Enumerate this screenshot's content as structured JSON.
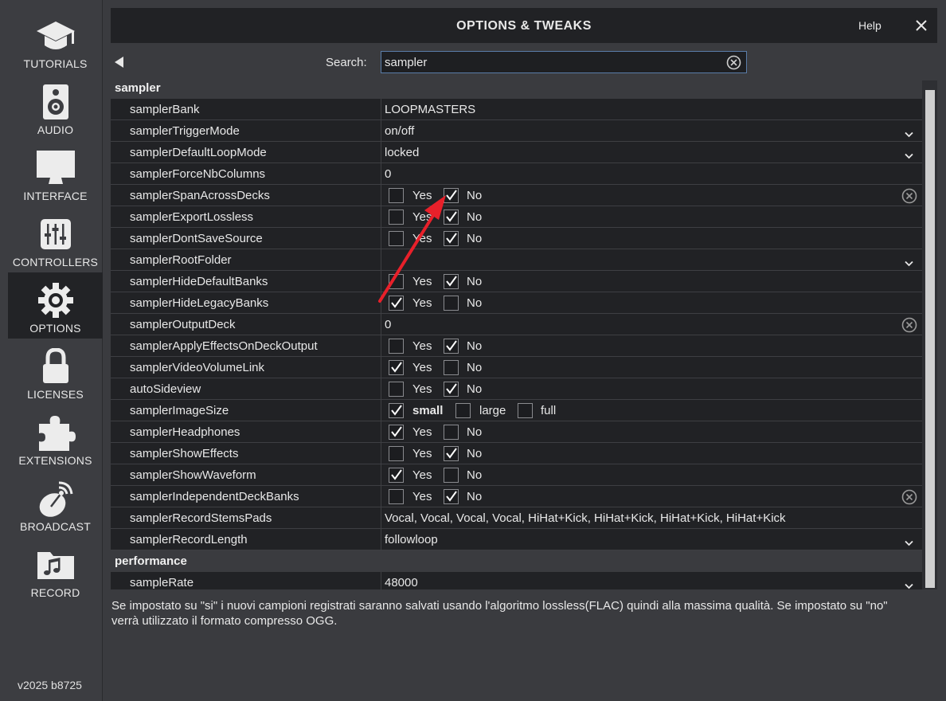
{
  "sidebar": {
    "items": [
      {
        "label": "TUTORIALS",
        "icon": "graduation-cap-icon"
      },
      {
        "label": "AUDIO",
        "icon": "speaker-icon"
      },
      {
        "label": "INTERFACE",
        "icon": "monitor-icon"
      },
      {
        "label": "CONTROLLERS",
        "icon": "sliders-icon"
      },
      {
        "label": "OPTIONS",
        "icon": "gear-icon",
        "active": true
      },
      {
        "label": "LICENSES",
        "icon": "lock-icon"
      },
      {
        "label": "EXTENSIONS",
        "icon": "puzzle-icon"
      },
      {
        "label": "BROADCAST",
        "icon": "satellite-dish-icon"
      },
      {
        "label": "RECORD",
        "icon": "music-folder-icon"
      }
    ],
    "version": "v2025 b8725"
  },
  "header": {
    "title": "OPTIONS & TWEAKS",
    "help": "Help"
  },
  "search": {
    "label": "Search:",
    "value": "sampler"
  },
  "colors": {
    "accent": "#5a7da8",
    "arrow": "#e8202a",
    "panel": "#212225",
    "background": "#3a3b3f"
  },
  "sections": {
    "sampler": "sampler",
    "performance": "performance"
  },
  "rows": [
    {
      "name": "samplerBank",
      "value": "LOOPMASTERS"
    },
    {
      "name": "samplerTriggerMode",
      "value": "on/off"
    },
    {
      "name": "samplerDefaultLoopMode",
      "value": "locked"
    },
    {
      "name": "samplerForceNbColumns",
      "value": "0"
    },
    {
      "name": "samplerSpanAcrossDecks",
      "yes": "Yes",
      "no": "No"
    },
    {
      "name": "samplerExportLossless",
      "yes": "Yes",
      "no": "No"
    },
    {
      "name": "samplerDontSaveSource",
      "yes": "Yes",
      "no": "No"
    },
    {
      "name": "samplerRootFolder",
      "value": ""
    },
    {
      "name": "samplerHideDefaultBanks",
      "yes": "Yes",
      "no": "No"
    },
    {
      "name": "samplerHideLegacyBanks",
      "yes": "Yes",
      "no": "No"
    },
    {
      "name": "samplerOutputDeck",
      "value": "0"
    },
    {
      "name": "samplerApplyEffectsOnDeckOutput",
      "yes": "Yes",
      "no": "No"
    },
    {
      "name": "samplerVideoVolumeLink",
      "yes": "Yes",
      "no": "No"
    },
    {
      "name": "autoSideview",
      "yes": "Yes",
      "no": "No"
    },
    {
      "name": "samplerImageSize",
      "opt1": "small",
      "opt2": "large",
      "opt3": "full"
    },
    {
      "name": "samplerHeadphones",
      "yes": "Yes",
      "no": "No"
    },
    {
      "name": "samplerShowEffects",
      "yes": "Yes",
      "no": "No"
    },
    {
      "name": "samplerShowWaveform",
      "yes": "Yes",
      "no": "No"
    },
    {
      "name": "samplerIndependentDeckBanks",
      "yes": "Yes",
      "no": "No"
    },
    {
      "name": "samplerRecordStemsPads",
      "value": "Vocal, Vocal, Vocal, Vocal, HiHat+Kick, HiHat+Kick, HiHat+Kick, HiHat+Kick"
    },
    {
      "name": "samplerRecordLength",
      "value": "followloop"
    },
    {
      "name": "sampleRate",
      "value": "48000"
    }
  ],
  "description": "Se impostato su \"si\" i nuovi campioni registrati saranno salvati usando l'algoritmo lossless(FLAC) quindi alla massima qualità. Se impostato su \"no\" verrà utilizzato il formato compresso OGG."
}
